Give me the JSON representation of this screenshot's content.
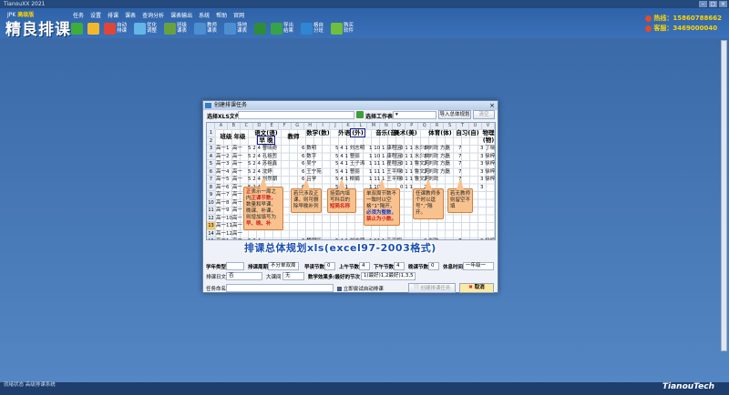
{
  "app": {
    "window_title": "TianouXX 2021",
    "logo_sub_a": "JPK",
    "logo_sub_b": "高级版",
    "logo": "精良排课",
    "brand": "TianouTech",
    "status": "就绪状态  高级排课系统"
  },
  "menu": [
    "任务",
    "设置",
    "排课",
    "课表",
    "查询分析",
    "课表输出",
    "系统",
    "帮助",
    "官网"
  ],
  "toolbar": [
    {
      "label": "",
      "icon": "add-icon",
      "color": "#3fae39"
    },
    {
      "label": "",
      "icon": "folder-icon",
      "color": "#f1b82c"
    },
    {
      "label": "自动排课",
      "icon": "color-wheel-icon",
      "color": "#e0453a"
    },
    {
      "label": "优化调整",
      "icon": "tune-icon",
      "color": "#63b6e6"
    },
    {
      "label": "班级课表",
      "icon": "grid-icon",
      "color": "#66a23f"
    },
    {
      "label": "教师课表",
      "icon": "grid-icon",
      "color": "#4c8fd0"
    },
    {
      "label": "场地课表",
      "icon": "grid-icon",
      "color": "#4c8fd0"
    },
    {
      "label": "",
      "icon": "save-icon",
      "color": "#2f8c3a"
    },
    {
      "label": "导出结果",
      "icon": "export-icon",
      "color": "#37a348"
    },
    {
      "label": "格自分班",
      "icon": "globe-icon",
      "color": "#2f86d1"
    },
    {
      "label": "购买软件",
      "icon": "cart-icon",
      "color": "#6fbe3c"
    }
  ],
  "contact": {
    "phone_label": "热线：15860788662",
    "qq_label": "客服：3469000040"
  },
  "dialog": {
    "title": "创建排课任务",
    "file_label": "选择XLS文件",
    "sheet_label": "选择工作表",
    "import_btn": "导入总体规划",
    "cancel_sm_btn": "清空",
    "col_letters": [
      "A",
      "B",
      "C",
      "D",
      "E",
      "F",
      "G",
      "H",
      "I",
      "J",
      "K",
      "L",
      "M",
      "N",
      "O",
      "P",
      "Q",
      "R",
      "S",
      "T",
      "U",
      "V"
    ],
    "row_numbers": [
      "1",
      "2",
      "3",
      "4",
      "5",
      "6",
      "7",
      "8",
      "9",
      "10",
      "11",
      "12",
      "13",
      "14",
      "15",
      "16",
      "17",
      "18",
      "19",
      "20"
    ],
    "selected_row": "13",
    "headers": {
      "class": "班级",
      "grade": "年级",
      "chinese": "语文(语)",
      "chinese_sub": "早 晚",
      "teacher": "教师",
      "math": "数学(数)",
      "english": "外语",
      "english_tag": "(外)",
      "music": "音乐(音)",
      "art": "美术(美)",
      "pe": "体育(体)",
      "self_study": "自习(自)",
      "physics": "物理(物)"
    },
    "rows": [
      {
        "c": "高一1",
        "g": "高一",
        "n": "5 2 4 曹晓奇",
        "m": "6 数明",
        "e": "5 4 1 刘志明",
        "mu": "1 10 1 康程因",
        "ar": "0 1 1 水少侠",
        "pe": "2 刘欢 方磊",
        "ss": "7",
        "ph": "3 丁晓伟"
      },
      {
        "c": "高一2",
        "g": "高一",
        "n": "5 2 4 孔祖哲",
        "m": "6 数字",
        "e": "5 4 1 曹丽",
        "mu": "1 10 1 康程因",
        "ar": "0 1 1 水少侠",
        "pe": "2 刘欢 方磊",
        "ss": "7",
        "ph": "3 徐梓阳"
      },
      {
        "c": "高一3",
        "g": "高一",
        "n": "5 2 4 苏祖鑫",
        "m": "6 吴宁",
        "e": "5 4 1 王子涛",
        "mu": "1 11 1 瞿程因",
        "ar": "0 1 1 鲁文芳",
        "pe": "2 刘欢 方磊",
        "ss": "7",
        "ph": "3 徐梓阳"
      },
      {
        "c": "高一4",
        "g": "高一",
        "n": "5 2 4 沈婷",
        "m": "6 王宁苑",
        "e": "5 4 1 曹丽",
        "mu": "1 11 1 王平翔",
        "ar": "0 1 1 鲁文芳",
        "pe": "2 刘欢 方磊",
        "ss": "7",
        "ph": "3 徐梓阳"
      },
      {
        "c": "高一5",
        "g": "高一",
        "n": "5 2 4 刘然朝",
        "m": "6 吕学",
        "e": "5 4 1 柳娟",
        "mu": "1 11 1 王平翔",
        "ar": "0 1 1 鲁文芳",
        "pe": "2 刘欢",
        "ss": "7",
        "ph": "3 徐梓阳"
      },
      {
        "c": "高一6",
        "g": "高一",
        "n": "5 2 4 ",
        "m": "6 ",
        "e": "5 4 1 ",
        "mu": "1 10 1 ",
        "ar": "0 1 1 ",
        "pe": "2 ",
        "ss": "7",
        "ph": "3 "
      },
      {
        "c": "高一7",
        "g": "高一",
        "n": "",
        "m": "",
        "e": "",
        "mu": "",
        "ar": "",
        "pe": "",
        "ss": "",
        "ph": ""
      },
      {
        "c": "高一8",
        "g": "高一",
        "n": "",
        "m": "",
        "e": "",
        "mu": "",
        "ar": "",
        "pe": "",
        "ss": "",
        "ph": ""
      },
      {
        "c": "高一9",
        "g": "高一",
        "n": "",
        "m": "",
        "e": "",
        "mu": "",
        "ar": "",
        "pe": "",
        "ss": "",
        "ph": ""
      },
      {
        "c": "高一10",
        "g": "高一",
        "n": "",
        "m": "",
        "e": "",
        "mu": "",
        "ar": "",
        "pe": "",
        "ss": "",
        "ph": ""
      },
      {
        "c": "高一11",
        "g": "高一",
        "n": "",
        "m": "",
        "e": "",
        "mu": "",
        "ar": "",
        "pe": "",
        "ss": "",
        "ph": ""
      },
      {
        "c": "高一12",
        "g": "高一",
        "n": "",
        "m": "",
        "e": "",
        "mu": "",
        "ar": "",
        "pe": "",
        "ss": "",
        "ph": ""
      },
      {
        "c": "高二1",
        "g": "高二",
        "n": "5 2 4 ",
        "m": "6 魏明旺",
        "e": "5 4 1 刘志明",
        "mu": "1 11 1 王平翔",
        "ar": "",
        "pe": "2 刘欢",
        "ss": "7",
        "ph": "3 徐梓阳"
      },
      {
        "c": "高二2",
        "g": "高二",
        "n": "5 2 4 ",
        "m": "6 杨明旺",
        "e": "5 4 1 刘志明",
        "mu": "1 11 1 王平翔",
        "ar": "",
        "pe": "2 刘欢",
        "ss": "7",
        "ph": "3 徐梓阳"
      },
      {
        "c": "高二3",
        "g": "高二",
        "n": "5 2 4 ",
        "m": "6 王光文",
        "e": "5 4 1 曹丽",
        "mu": "1 11 1 王平翔",
        "ar": "",
        "pe": "2 刘欢",
        "ss": "7",
        "ph": "3 徐梓阳"
      },
      {
        "c": "高二4",
        "g": "高二",
        "n": "5 2 4 ",
        "m": "6 王光文",
        "e": "5 4 1 曹丽",
        "mu": "1 11 1 王平翔",
        "ar": "",
        "pe": "2 刘欢",
        "ss": "7",
        "ph": "3 徐梓阳"
      },
      {
        "c": "高二5",
        "g": "高二",
        "n": "5 2 4 ",
        "m": "6 杨杰",
        "e": "5 4 1 刘志明",
        "mu": "1 11 1 王平翔",
        "ar": "",
        "pe": "2 刘欢",
        "ss": "7",
        "ph": "3 徐梓阳"
      },
      {
        "c": "高二6",
        "g": "高二",
        "n": "5 2 4 ",
        "m": "6 杨杰",
        "e": "5 4 1 刘志明",
        "mu": "1 11 1 王平翔",
        "ar": "",
        "pe": "2 刘欢",
        "ss": "7",
        "ph": "3 徐梓阳"
      }
    ],
    "callouts": {
      "c1_a": "正",
      "c1_b": "表示一周之内",
      "c1_c": "正课节数，",
      "c1_d": "数量和早课、晚课、补课，",
      "c1_e": "则增加填写为",
      "c1_f": "早、晚、补",
      "c2": "若只涉及正课，则可删除早晚补列",
      "c3_a": "括弧内填写科目的",
      "c3_b": "短简名称",
      "c4_a": "单双周节数不一致时以空格“1”隔开，",
      "c4_b": "必须为整数，",
      "c4_c": "禁止为小数。",
      "c5_a": "任课教师多个时以逗号“,”隔开。",
      "c6": "若无教师则留空不填"
    },
    "banner": "排课总体规划xls(excel97-2003格式)",
    "form": {
      "school_type_label": "学年类型",
      "school_type_value": "",
      "week_rule_label": "排课周期",
      "week_rule_value": "不分单双周",
      "days_label": "早读节数",
      "days_value": "0",
      "morning_label": "上午节数",
      "morning_value": "4",
      "afternoon_label": "下午节数",
      "afternoon_value": "4",
      "evening_label": "晚课节数",
      "evening_value": "0",
      "rest_label": "休息时间",
      "rest_value": "一年级一",
      "start_label": "排课日文",
      "start_value": "否",
      "limit_label": "大课间",
      "limit_value": "无",
      "count_label": "数学效果多/最好的节次",
      "count_value": "1(最好)1,2最好)1,3,5",
      "task_label": "任务命名",
      "task_value": "",
      "auto_check_label": "立即尝试自动排课",
      "create_btn": "创建排课任务",
      "cancel_btn": "取消"
    }
  }
}
